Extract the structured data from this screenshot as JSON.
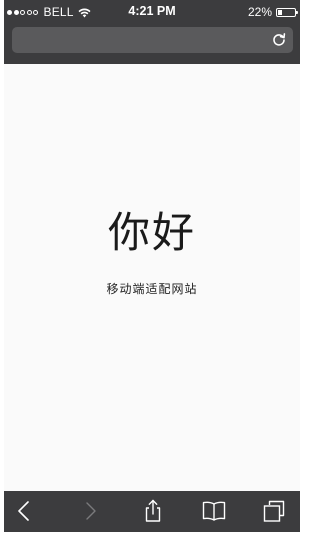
{
  "status_bar": {
    "carrier": "BELL",
    "time": "4:21 PM",
    "battery_percent_text": "22%",
    "battery_level": 0.22,
    "signal_bars_filled": 2,
    "signal_bars_total": 5,
    "wifi_icon": "wifi-icon"
  },
  "address_bar": {
    "url": "",
    "reload_icon": "reload-icon"
  },
  "page": {
    "heading": "你好",
    "subtitle": "移动端适配网站"
  },
  "toolbar": {
    "icons": [
      "back-icon",
      "forward-icon",
      "share-icon",
      "bookmarks-icon",
      "tabs-icon"
    ],
    "forward_enabled": false
  },
  "colors": {
    "chrome": "#3c3c3e",
    "address_field": "#5a5a5c",
    "page_background": "#fafafa",
    "icon": "#ffffff",
    "icon_disabled": "#7a7a7c"
  }
}
